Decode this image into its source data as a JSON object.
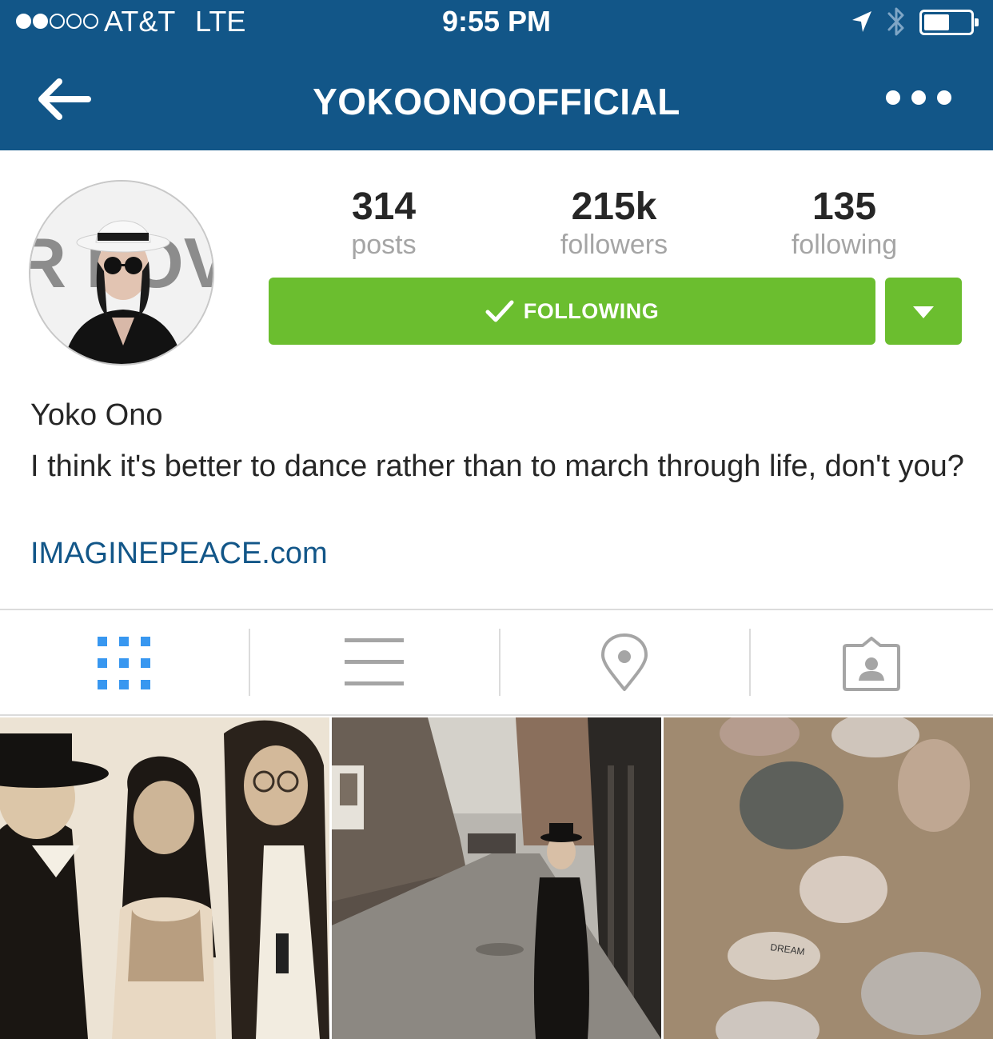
{
  "status_bar": {
    "carrier": "AT&T",
    "network": "LTE",
    "time": "9:55 PM",
    "signal_bars": 2,
    "signal_total": 5,
    "battery_level": 0.55
  },
  "nav": {
    "title": "YOKOONOOFFICIAL",
    "back_icon": "back-arrow-icon",
    "more_icon": "more-options-icon"
  },
  "profile": {
    "stats": {
      "posts": {
        "value": "314",
        "label": "posts"
      },
      "followers": {
        "value": "215k",
        "label": "followers"
      },
      "following": {
        "value": "135",
        "label": "following"
      }
    },
    "follow_button": {
      "label": "FOLLOWING",
      "icon": "checkmark-icon"
    },
    "dropdown_icon": "caret-down-icon",
    "name": "Yoko Ono",
    "bio": "I think it's better to dance rather than to march through life, don't you?",
    "link": "IMAGINEPEACE.com"
  },
  "tabs": [
    {
      "icon": "grid-view-icon",
      "active": true
    },
    {
      "icon": "list-view-icon",
      "active": false
    },
    {
      "icon": "location-pin-icon",
      "active": false
    },
    {
      "icon": "tagged-photos-icon",
      "active": false
    }
  ],
  "grid_images": [
    {
      "icon": "photo-thumbnail",
      "description_tag": "sepia-group-photo"
    },
    {
      "icon": "photo-thumbnail",
      "description_tag": "street-photo"
    },
    {
      "icon": "photo-thumbnail",
      "description_tag": "stones-photo",
      "stone_text": "DREAM"
    }
  ],
  "colors": {
    "header_bg": "#125688",
    "follow_green": "#6bbe2f",
    "link_blue": "#125688",
    "active_tab_blue": "#3897f0",
    "inactive_tab_gray": "#a5a5a5"
  }
}
